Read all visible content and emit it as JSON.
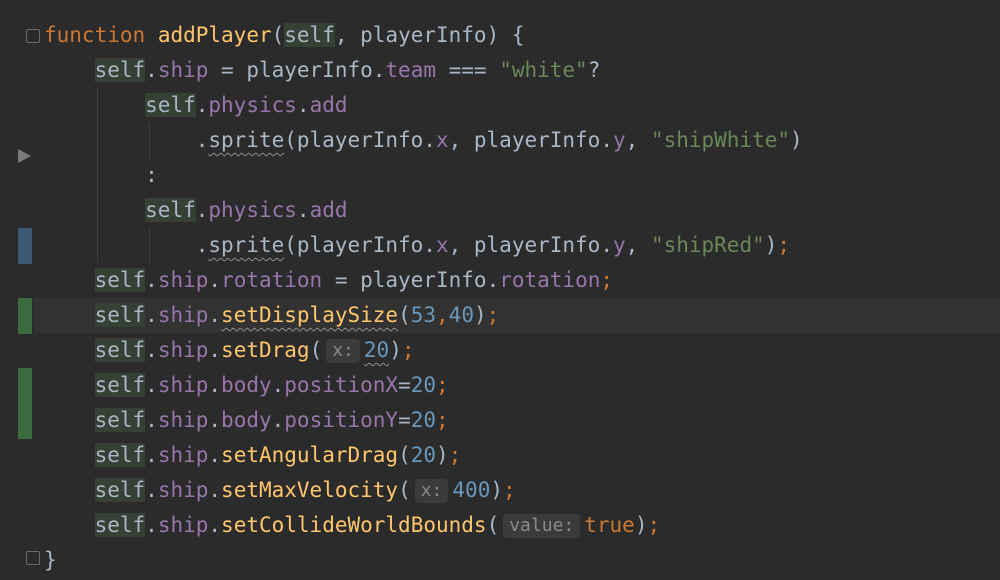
{
  "editor": {
    "header": {
      "kw_function": "function",
      "fn_name": "addPlayer",
      "open": "(",
      "param_self": "self",
      "sep": ", ",
      "param_info": "playerInfo",
      "close": ") {"
    },
    "l2": {
      "self": "self",
      "dot": ".",
      "ship": "ship",
      "eq": " = playerInfo.",
      "team": "team",
      "op": " === ",
      "str": "\"white\"",
      "tail": "?"
    },
    "l3": {
      "self": "self",
      "dot": ".",
      "physics": "physics",
      "dot2": ".",
      "add": "add"
    },
    "l4": {
      "dot": ".",
      "sprite": "sprite",
      "open": "(playerInfo.",
      "x": "x",
      "mid": ", playerInfo.",
      "y": "y",
      "sep": ", ",
      "str": "\"shipWhite\"",
      "close": ")"
    },
    "l5": {
      "colon": ":"
    },
    "l6": {
      "self": "self",
      "dot": ".",
      "physics": "physics",
      "dot2": ".",
      "add": "add"
    },
    "l7": {
      "dot": ".",
      "sprite": "sprite",
      "open": "(playerInfo.",
      "x": "x",
      "mid": ", playerInfo.",
      "y": "y",
      "sep": ", ",
      "str": "\"shipRed\"",
      "close": ")",
      "semi": ";"
    },
    "l8": {
      "self": "self",
      "dot": ".",
      "ship": "ship",
      "dot2": ".",
      "rotation": "rotation",
      "eq": " = playerInfo.",
      "rotation2": "rotation",
      "semi": ";"
    },
    "l9": {
      "self": "self",
      "dot": ".",
      "ship": "ship",
      "dot2": ".",
      "method": "setDisplaySize",
      "open": "(",
      "n1": "53",
      "comma": ",",
      "n2": "40",
      "close": ")",
      "semi": ";"
    },
    "l10": {
      "self": "self",
      "dot": ".",
      "ship": "ship",
      "dot2": ".",
      "method": "setDrag",
      "open": "(",
      "hint": "x:",
      "n1": "20",
      "close": ")",
      "semi": ";"
    },
    "l11": {
      "self": "self",
      "dot": ".",
      "ship": "ship",
      "dot2": ".",
      "body": "body",
      "dot3": ".",
      "prop": "positionX",
      "eq": "=",
      "n1": "20",
      "semi": ";"
    },
    "l12": {
      "self": "self",
      "dot": ".",
      "ship": "ship",
      "dot2": ".",
      "body": "body",
      "dot3": ".",
      "prop": "positionY",
      "eq": "=",
      "n1": "20",
      "semi": ";"
    },
    "l13": {
      "self": "self",
      "dot": ".",
      "ship": "ship",
      "dot2": ".",
      "method": "setAngularDrag",
      "open": "(",
      "n1": "20",
      "close": ")",
      "semi": ";"
    },
    "l14": {
      "self": "self",
      "dot": ".",
      "ship": "ship",
      "dot2": ".",
      "method": "setMaxVelocity",
      "open": "(",
      "hint": "x:",
      "n1": "400",
      "close": ")",
      "semi": ";"
    },
    "l15": {
      "self": "self",
      "dot": ".",
      "ship": "ship",
      "dot2": ".",
      "method": "setCollideWorldBounds",
      "open": "(",
      "hint": "value:",
      "val": "true",
      "close": ")",
      "semi": ";"
    },
    "l16": {
      "brace": "}"
    }
  },
  "colors": {
    "background": "#2b2b2b",
    "keyword": "#cc7832",
    "function": "#ffc66d",
    "property": "#9876aa",
    "string": "#6a8759",
    "number": "#6897bb",
    "text": "#a9b7c6",
    "change_modified": "#3c5a76",
    "change_added": "#3b6b3e"
  }
}
